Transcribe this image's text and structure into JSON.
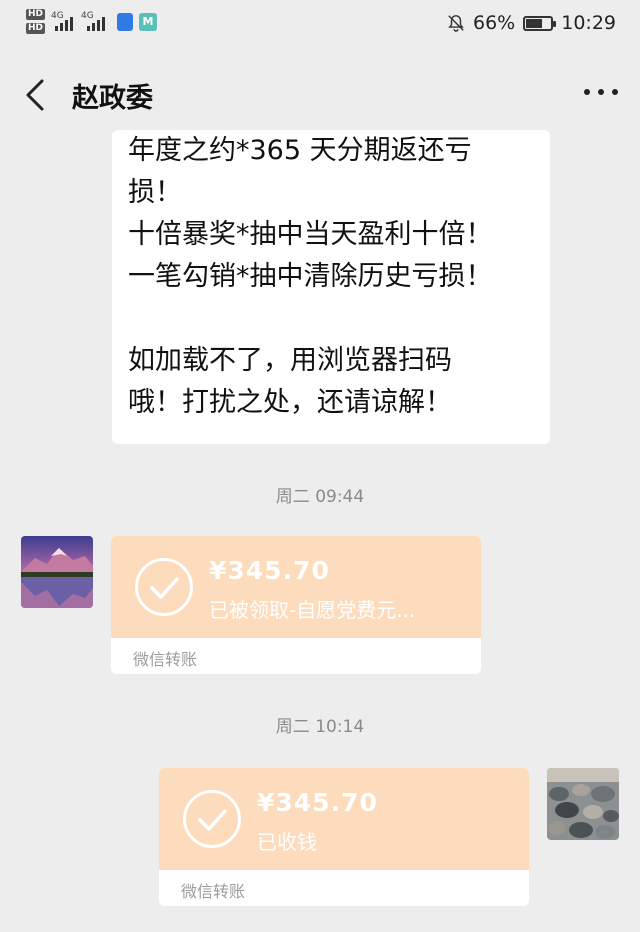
{
  "status_bar": {
    "hd1": "HD",
    "hd2": "HD",
    "net1": "4G",
    "net2": "4G",
    "battery_percent": "66%",
    "battery_level": 0.66,
    "time": "10:29",
    "icons": [
      "hd-icon",
      "signal-icon",
      "shield-icon",
      "m-app-icon",
      "mute-bell-icon",
      "battery-icon"
    ]
  },
  "nav": {
    "title": "赵政委",
    "back_icon": "chevron-left-icon",
    "more_icon": "more-dots-icon"
  },
  "messages": {
    "text_lines": [
      "年度之约*365 天分期返还亏",
      "损！",
      "十倍暴奖*抽中当天盈利十倍！",
      "一笔勾销*抽中清除历史亏损！",
      "",
      "如加载不了，用浏览器扫码",
      "哦！打扰之处，还请谅解！"
    ],
    "time1": "周二 09:44",
    "transfer_received": {
      "amount": "¥345.70",
      "status": "已被领取-自愿党费元...",
      "caption": "微信转账"
    },
    "time2": "周二 10:14",
    "transfer_sent": {
      "amount": "¥345.70",
      "status": "已收钱",
      "caption": "微信转账"
    }
  },
  "colors": {
    "background": "#ededed",
    "transfer_orange": "#fcdcbc",
    "bubble": "#ffffff"
  }
}
